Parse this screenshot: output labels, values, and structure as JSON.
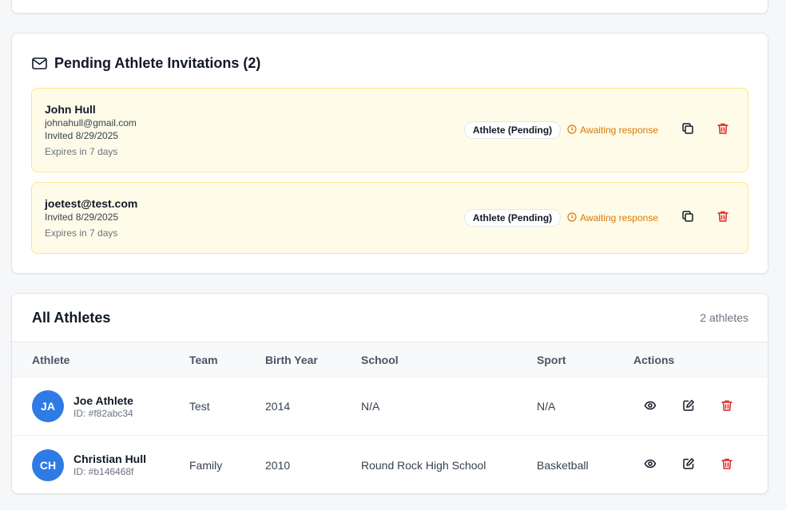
{
  "pending": {
    "title": "Pending Athlete Invitations (2)",
    "invites": [
      {
        "name": "John Hull",
        "email": "johnahull@gmail.com",
        "invited": "Invited 8/29/2025",
        "expires": "Expires in 7 days",
        "badge": "Athlete (Pending)",
        "status": "Awaiting response"
      },
      {
        "name": "joetest@test.com",
        "invited": "Invited 8/29/2025",
        "expires": "Expires in 7 days",
        "badge": "Athlete (Pending)",
        "status": "Awaiting response"
      }
    ]
  },
  "athletes": {
    "title": "All Athletes",
    "count": "2 athletes",
    "columns": [
      "Athlete",
      "Team",
      "Birth Year",
      "School",
      "Sport",
      "Actions"
    ],
    "rows": [
      {
        "initials": "JA",
        "name": "Joe Athlete",
        "id": "ID: #f82abc34",
        "team": "Test",
        "birth_year": "2014",
        "school": "N/A",
        "sport": "N/A"
      },
      {
        "initials": "CH",
        "name": "Christian Hull",
        "id": "ID: #b146468f",
        "team": "Family",
        "birth_year": "2010",
        "school": "Round Rock High School",
        "sport": "Basketball"
      }
    ]
  },
  "icons": {
    "title_icon": "mail-icon",
    "copy": "copy-icon",
    "delete": "trash-icon",
    "view": "eye-icon",
    "edit": "edit-icon",
    "status": "clock-icon"
  },
  "colors": {
    "accent": "#2f7be5",
    "pending_bg": "#fefce8",
    "pending_border": "#fde68a",
    "status": "#d97706",
    "danger": "#dc2626"
  }
}
